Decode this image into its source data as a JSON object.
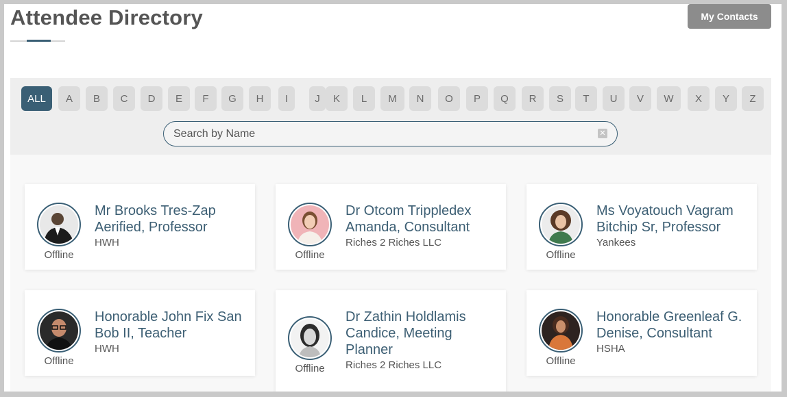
{
  "header": {
    "title": "Attendee Directory",
    "my_contacts_label": "My Contacts",
    "accent_color": "#3a5f75"
  },
  "filter": {
    "letters": [
      "ALL",
      "A",
      "B",
      "C",
      "D",
      "E",
      "F",
      "G",
      "H",
      "I",
      "J",
      "K",
      "L",
      "M",
      "N",
      "O",
      "P",
      "Q",
      "R",
      "S",
      "T",
      "U",
      "V",
      "W",
      "X",
      "Y",
      "Z"
    ],
    "active_letter": "ALL",
    "search_placeholder": "Search by Name",
    "clear_icon": "clear-x-icon"
  },
  "attendees": [
    {
      "name": "Mr Brooks Tres-Zap Aerified, Professor",
      "company": "HWH",
      "status": "Offline",
      "avatar": "man-in-suit-photo"
    },
    {
      "name": "Dr Otcom Trippledex Amanda, Consultant",
      "company": "Riches 2 Riches LLC",
      "status": "Offline",
      "avatar": "woman-pink-background-photo"
    },
    {
      "name": "Ms Voyatouch Vagram Bitchip Sr, Professor",
      "company": "Yankees",
      "status": "Offline",
      "avatar": "woman-curly-hair-photo"
    },
    {
      "name": "Honorable John Fix San Bob II, Teacher",
      "company": "HWH",
      "status": "Offline",
      "avatar": "man-with-glasses-photo"
    },
    {
      "name": "Dr Zathin Holdlamis Candice, Meeting Planner",
      "company": "Riches 2 Riches LLC",
      "status": "Offline",
      "avatar": "woman-black-white-photo"
    },
    {
      "name": "Honorable Greenleaf G. Denise, Consultant",
      "company": "HSHA",
      "status": "Offline",
      "avatar": "woman-orange-shirt-photo"
    }
  ]
}
